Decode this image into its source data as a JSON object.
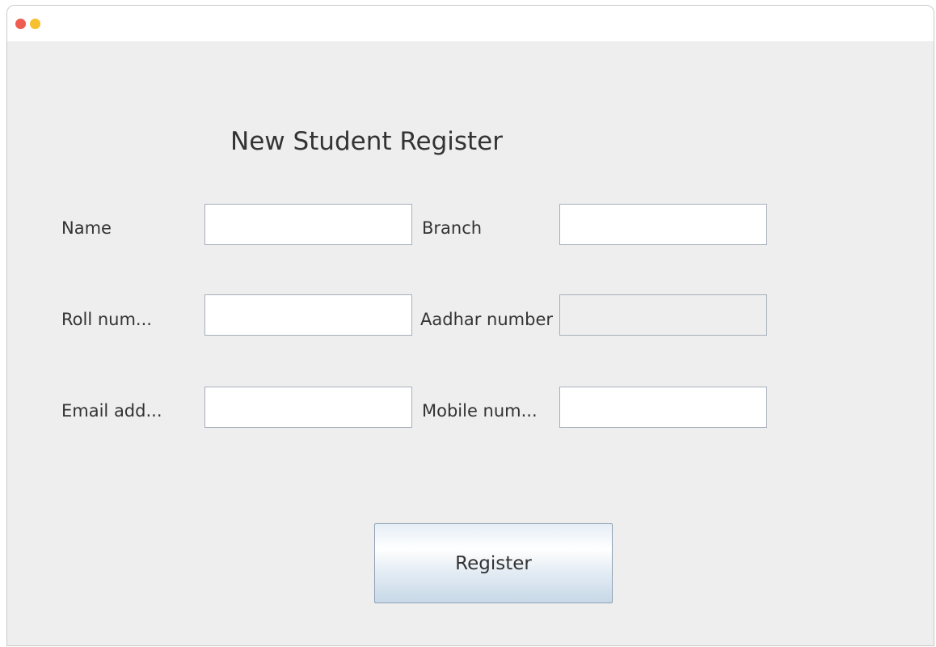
{
  "window": {
    "traffic_lights": {
      "close_color": "#ee5c52",
      "minimize_color": "#f6c02f"
    }
  },
  "form": {
    "title": "New Student Register",
    "fields": {
      "name": {
        "label": "Name",
        "value": ""
      },
      "branch": {
        "label": "Branch",
        "value": ""
      },
      "roll_number": {
        "label": "Roll num...",
        "value": ""
      },
      "aadhar_number": {
        "label": "Aadhar number",
        "value": ""
      },
      "email_address": {
        "label": "Email add...",
        "value": ""
      },
      "mobile_number": {
        "label": "Mobile num...",
        "value": ""
      }
    },
    "register_label": "Register"
  }
}
